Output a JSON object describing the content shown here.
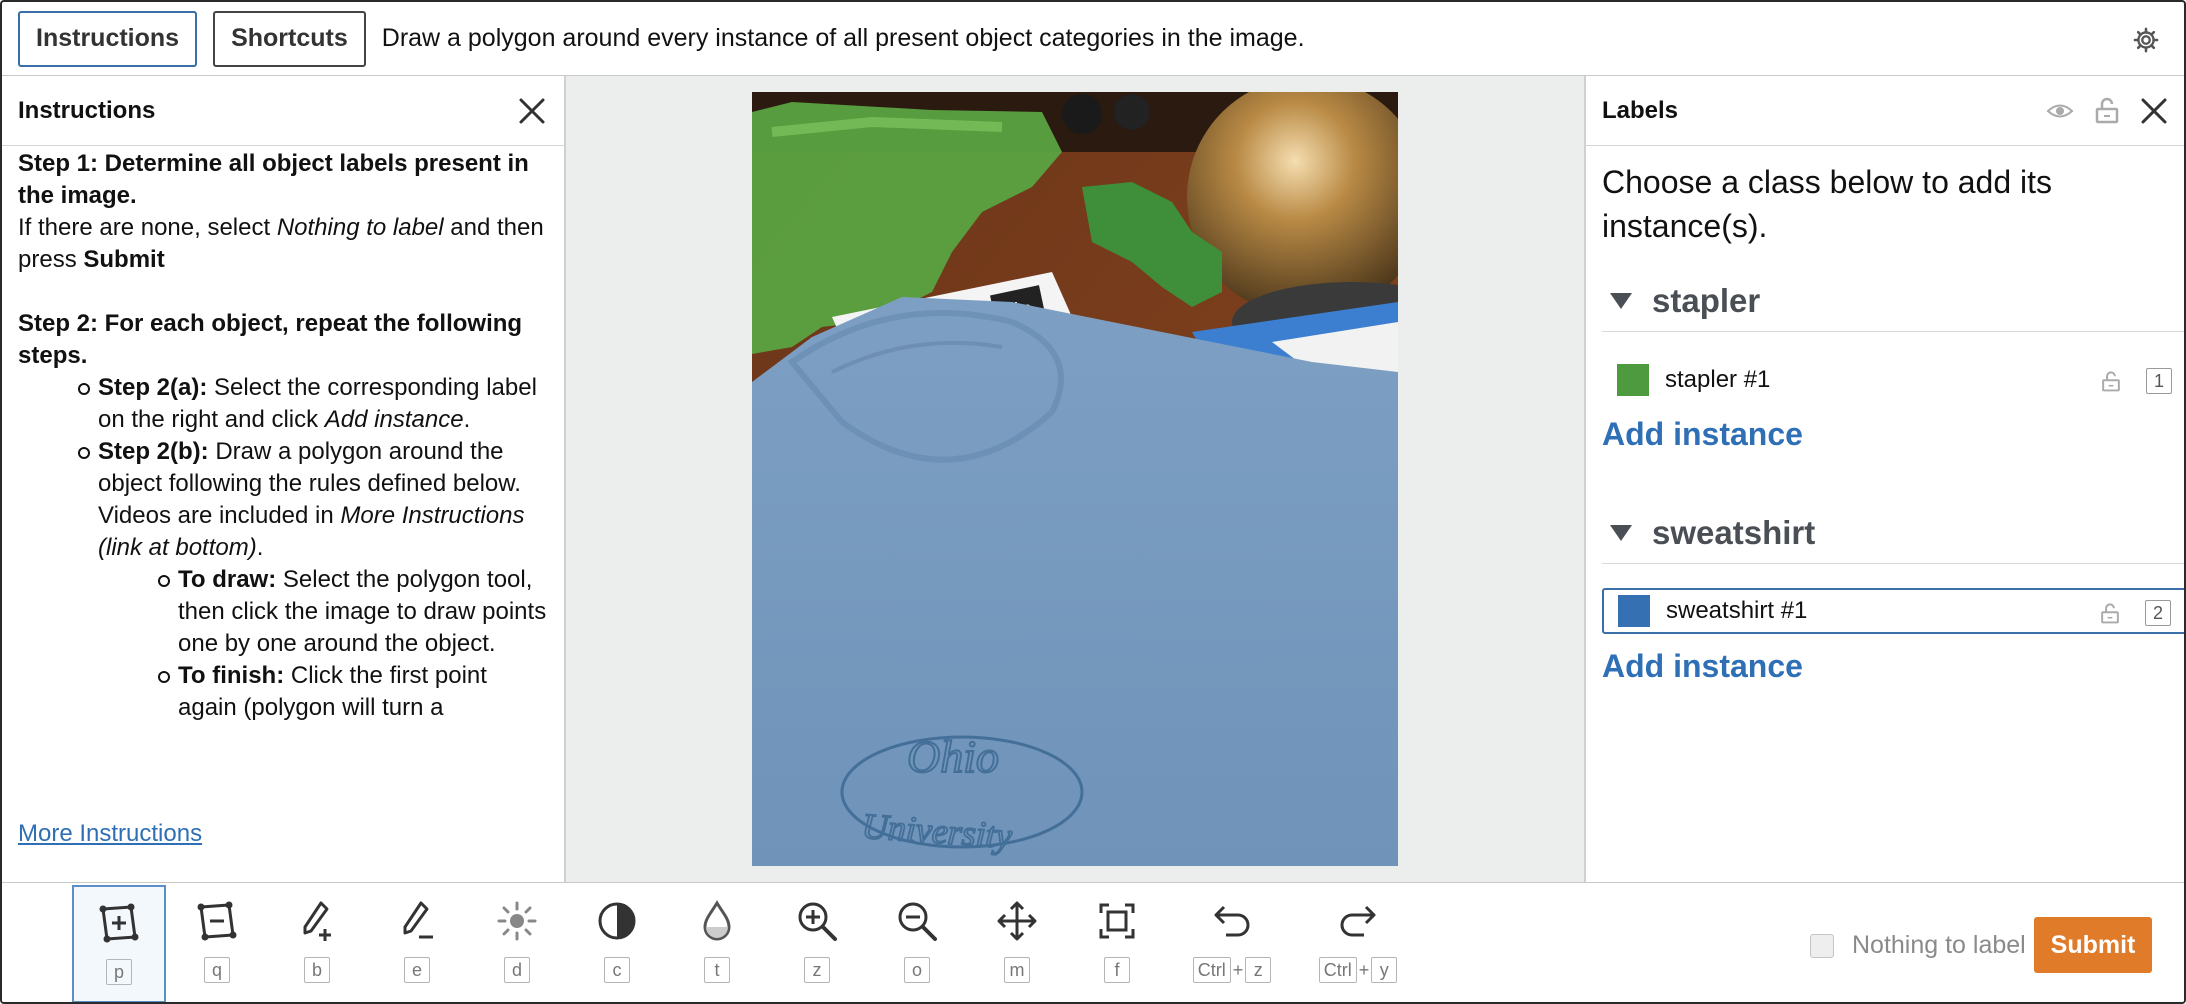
{
  "header": {
    "instructions_tab": "Instructions",
    "shortcuts_tab": "Shortcuts",
    "task": "Draw a polygon around every instance of all present object categories in the image."
  },
  "instructions_panel": {
    "title": "Instructions",
    "step1_bold": "Step 1: Determine all object labels present in the image.",
    "step1_text_a": "If there are none, select ",
    "step1_em": "Nothing to label",
    "step1_text_b": " and then press ",
    "step1_submit": "Submit",
    "step2_bold": "Step 2: For each object, repeat the following steps.",
    "step2a_bold": "Step 2(a):",
    "step2a_text": " Select the corresponding label on the right and click ",
    "step2a_em": "Add instance",
    "step2a_end": ".",
    "step2b_bold": "Step 2(b):",
    "step2b_text": " Draw a polygon around the object following the rules defined below. Videos are included in ",
    "step2b_em": "More Instructions (link at bottom)",
    "step2b_end": ".",
    "draw_bold": "To draw:",
    "draw_text": " Select the polygon tool, then click the image to draw points one by one around the object.",
    "finish_bold": "To finish:",
    "finish_text": " Click the first point again (polygon will turn a",
    "more_link": "More Instructions"
  },
  "labels_panel": {
    "title": "Labels",
    "hint": "Choose a class below to add its instance(s).",
    "classes": [
      {
        "name": "stapler",
        "instances": [
          {
            "label": "stapler #1",
            "color": "#4e9a3e",
            "key": "1"
          }
        ],
        "add_label": "Add instance"
      },
      {
        "name": "sweatshirt",
        "instances": [
          {
            "label": "sweatshirt #1",
            "color": "#3570b2",
            "key": "2"
          }
        ],
        "add_label": "Add instance"
      }
    ]
  },
  "image": {
    "embroidery_line1": "Ohio",
    "embroidery_line2": "University",
    "card_text": "hp"
  },
  "toolbar": {
    "tools": [
      {
        "name": "polygon-add",
        "key": "p"
      },
      {
        "name": "polygon-subtract",
        "key": "q"
      },
      {
        "name": "brush-add",
        "key": "b"
      },
      {
        "name": "brush-erase",
        "key": "e"
      },
      {
        "name": "brightness",
        "key": "d"
      },
      {
        "name": "contrast",
        "key": "c"
      },
      {
        "name": "transparency",
        "key": "t"
      },
      {
        "name": "zoom-in",
        "key": "z"
      },
      {
        "name": "zoom-out",
        "key": "o"
      },
      {
        "name": "move",
        "key": "m"
      },
      {
        "name": "fit",
        "key": "f"
      }
    ],
    "undo_mod": "Ctrl",
    "undo_plus": "+",
    "undo_key": "z",
    "redo_mod": "Ctrl",
    "redo_plus": "+",
    "redo_key": "y",
    "nothing_label": "Nothing to label",
    "submit": "Submit"
  },
  "colors": {
    "accent_blue": "#2f6fb5",
    "submit_orange": "#e07b2a",
    "stapler_green": "#4e9a3e",
    "sweatshirt_blue": "#3570b2"
  }
}
